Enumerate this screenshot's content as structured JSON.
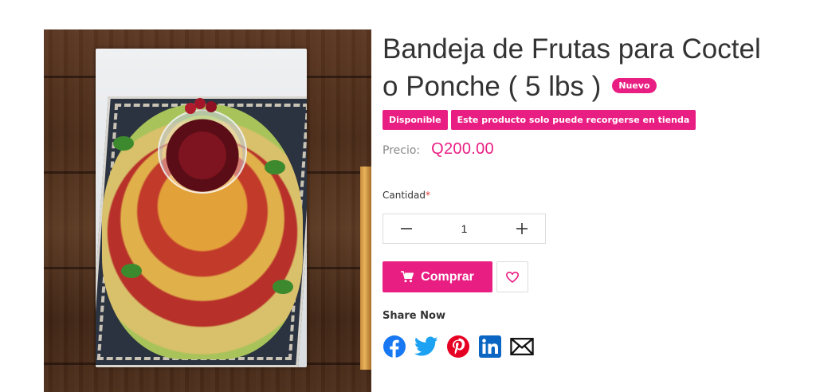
{
  "product": {
    "title": "Bandeja de Frutas para Coctel o Ponche ( 5 lbs )",
    "badge_new": "Nuevo",
    "tags": [
      "Disponible",
      "Este producto solo puede recorgerse en tienda"
    ],
    "price_label": "Precio:",
    "price_value": "Q200.00",
    "image_icon": "fruit-tray-photo"
  },
  "quantity": {
    "label": "Cantidad",
    "required_mark": "*",
    "value": "1",
    "decrement_icon": "minus-icon",
    "increment_icon": "plus-icon"
  },
  "actions": {
    "buy_label": "Comprar",
    "buy_icon": "cart-icon",
    "wishlist_icon": "heart-icon"
  },
  "share": {
    "title": "Share Now",
    "networks": [
      "facebook",
      "twitter",
      "pinterest",
      "linkedin",
      "email"
    ]
  },
  "colors": {
    "accent": "#e91e83",
    "facebook": "#1877f2",
    "twitter": "#1da1f2",
    "pinterest": "#e60023",
    "linkedin": "#0a66c2"
  }
}
